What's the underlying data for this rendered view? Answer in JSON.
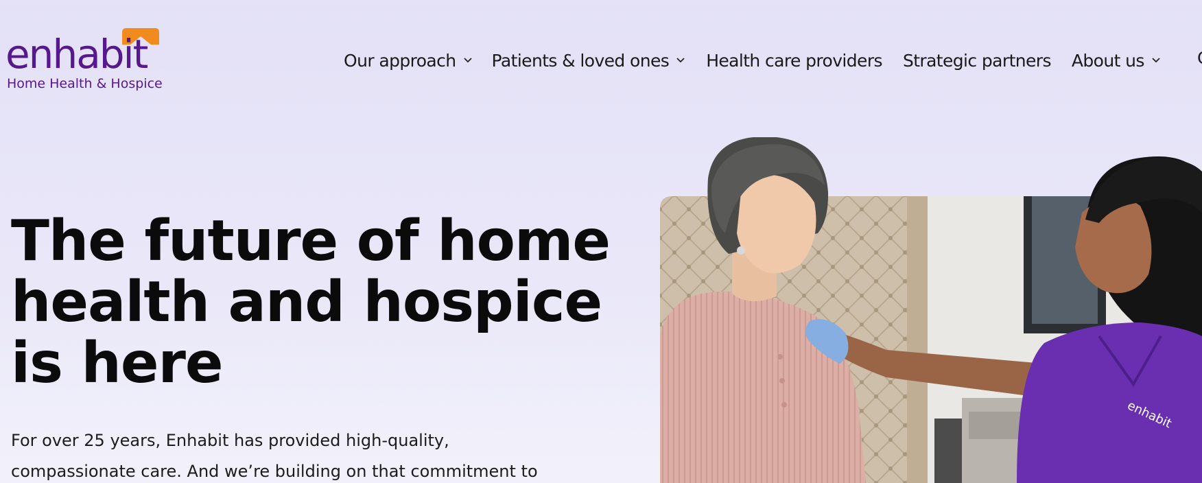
{
  "brand": {
    "name": "enhabit",
    "tagline": "Home Health & Hospice",
    "color": "#56188d",
    "accent": "#f28b1e"
  },
  "nav": {
    "items": [
      {
        "label": "Our approach",
        "has_dropdown": true
      },
      {
        "label": "Patients & loved ones",
        "has_dropdown": true
      },
      {
        "label": "Health care providers",
        "has_dropdown": false
      },
      {
        "label": "Strategic partners",
        "has_dropdown": false
      },
      {
        "label": "About us",
        "has_dropdown": true
      }
    ],
    "clipped": "C"
  },
  "hero": {
    "title_lines": [
      "The future of home",
      "health and hospice",
      "is here"
    ],
    "body_lines": [
      "For over 25 years, Enhabit has provided high-quality,",
      "compassionate care. And we’re building on that commitment to"
    ],
    "image_alt": "Enhabit nurse in purple scrubs with hand on older woman's shoulder",
    "scrub_logo_text": "enhabit"
  }
}
